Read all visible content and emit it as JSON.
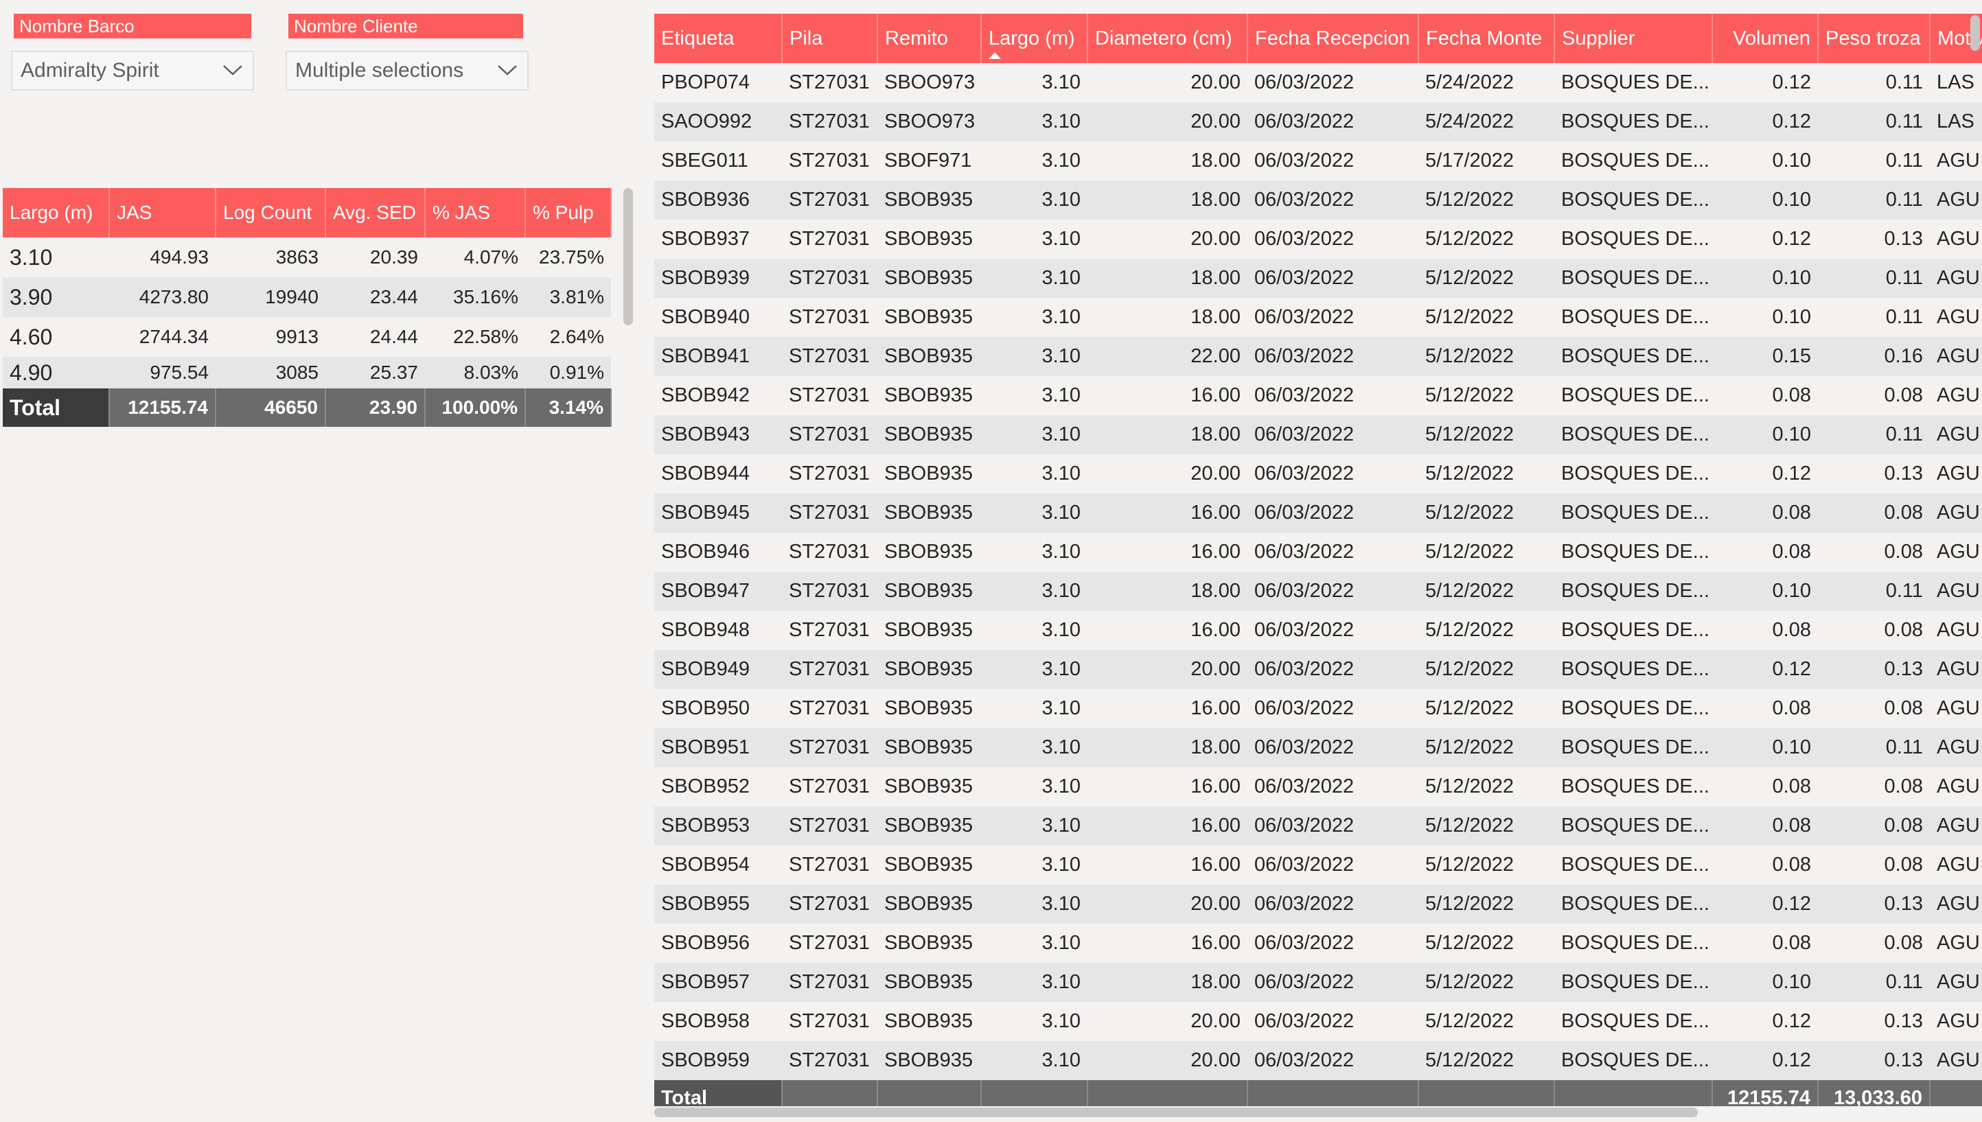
{
  "slicers": [
    {
      "title": "Nombre Barco",
      "value": "Admiralty Spirit"
    },
    {
      "title": "Nombre Cliente",
      "value": "Multiple selections"
    }
  ],
  "summary": {
    "headers": [
      "Largo (m)",
      "JAS",
      "Log Count",
      "Avg. SED",
      "% JAS",
      "% Pulp"
    ],
    "rows": [
      [
        "3.10",
        "494.93",
        "3863",
        "20.39",
        "4.07%",
        "23.75%"
      ],
      [
        "3.90",
        "4273.80",
        "19940",
        "23.44",
        "35.16%",
        "3.81%"
      ],
      [
        "4.60",
        "2744.34",
        "9913",
        "24.44",
        "22.58%",
        "2.64%"
      ],
      [
        "4.90",
        "975.54",
        "3085",
        "25.37",
        "8.03%",
        "0.91%"
      ]
    ],
    "total": [
      "Total",
      "12155.74",
      "46650",
      "23.90",
      "100.00%",
      "3.14%"
    ]
  },
  "detail": {
    "headers": [
      "Etiqueta",
      "Pila",
      "Remito",
      "Largo (m)",
      "Diametero (cm)",
      "Fecha Recepcion",
      "Fecha Monte",
      "Supplier",
      "Volumen",
      "Peso troza",
      "Motivo"
    ],
    "rows": [
      [
        "PBOP074",
        "ST27031",
        "SBOO973",
        "3.10",
        "20.00",
        "06/03/2022",
        "5/24/2022",
        "BOSQUES DE...",
        "0.12",
        "0.11",
        "LAS"
      ],
      [
        "SAOO992",
        "ST27031",
        "SBOO973",
        "3.10",
        "20.00",
        "06/03/2022",
        "5/24/2022",
        "BOSQUES DE...",
        "0.12",
        "0.11",
        "LAS"
      ],
      [
        "SBEG011",
        "ST27031",
        "SBOF971",
        "3.10",
        "18.00",
        "06/03/2022",
        "5/17/2022",
        "BOSQUES DE...",
        "0.10",
        "0.11",
        "AGU"
      ],
      [
        "SBOB936",
        "ST27031",
        "SBOB935",
        "3.10",
        "18.00",
        "06/03/2022",
        "5/12/2022",
        "BOSQUES DE...",
        "0.10",
        "0.11",
        "AGU"
      ],
      [
        "SBOB937",
        "ST27031",
        "SBOB935",
        "3.10",
        "20.00",
        "06/03/2022",
        "5/12/2022",
        "BOSQUES DE...",
        "0.12",
        "0.13",
        "AGU"
      ],
      [
        "SBOB939",
        "ST27031",
        "SBOB935",
        "3.10",
        "18.00",
        "06/03/2022",
        "5/12/2022",
        "BOSQUES DE...",
        "0.10",
        "0.11",
        "AGU"
      ],
      [
        "SBOB940",
        "ST27031",
        "SBOB935",
        "3.10",
        "18.00",
        "06/03/2022",
        "5/12/2022",
        "BOSQUES DE...",
        "0.10",
        "0.11",
        "AGU"
      ],
      [
        "SBOB941",
        "ST27031",
        "SBOB935",
        "3.10",
        "22.00",
        "06/03/2022",
        "5/12/2022",
        "BOSQUES DE...",
        "0.15",
        "0.16",
        "AGU"
      ],
      [
        "SBOB942",
        "ST27031",
        "SBOB935",
        "3.10",
        "16.00",
        "06/03/2022",
        "5/12/2022",
        "BOSQUES DE...",
        "0.08",
        "0.08",
        "AGU"
      ],
      [
        "SBOB943",
        "ST27031",
        "SBOB935",
        "3.10",
        "18.00",
        "06/03/2022",
        "5/12/2022",
        "BOSQUES DE...",
        "0.10",
        "0.11",
        "AGU"
      ],
      [
        "SBOB944",
        "ST27031",
        "SBOB935",
        "3.10",
        "20.00",
        "06/03/2022",
        "5/12/2022",
        "BOSQUES DE...",
        "0.12",
        "0.13",
        "AGU"
      ],
      [
        "SBOB945",
        "ST27031",
        "SBOB935",
        "3.10",
        "16.00",
        "06/03/2022",
        "5/12/2022",
        "BOSQUES DE...",
        "0.08",
        "0.08",
        "AGU"
      ],
      [
        "SBOB946",
        "ST27031",
        "SBOB935",
        "3.10",
        "16.00",
        "06/03/2022",
        "5/12/2022",
        "BOSQUES DE...",
        "0.08",
        "0.08",
        "AGU"
      ],
      [
        "SBOB947",
        "ST27031",
        "SBOB935",
        "3.10",
        "18.00",
        "06/03/2022",
        "5/12/2022",
        "BOSQUES DE...",
        "0.10",
        "0.11",
        "AGU"
      ],
      [
        "SBOB948",
        "ST27031",
        "SBOB935",
        "3.10",
        "16.00",
        "06/03/2022",
        "5/12/2022",
        "BOSQUES DE...",
        "0.08",
        "0.08",
        "AGU"
      ],
      [
        "SBOB949",
        "ST27031",
        "SBOB935",
        "3.10",
        "20.00",
        "06/03/2022",
        "5/12/2022",
        "BOSQUES DE...",
        "0.12",
        "0.13",
        "AGU"
      ],
      [
        "SBOB950",
        "ST27031",
        "SBOB935",
        "3.10",
        "16.00",
        "06/03/2022",
        "5/12/2022",
        "BOSQUES DE...",
        "0.08",
        "0.08",
        "AGU"
      ],
      [
        "SBOB951",
        "ST27031",
        "SBOB935",
        "3.10",
        "18.00",
        "06/03/2022",
        "5/12/2022",
        "BOSQUES DE...",
        "0.10",
        "0.11",
        "AGU"
      ],
      [
        "SBOB952",
        "ST27031",
        "SBOB935",
        "3.10",
        "16.00",
        "06/03/2022",
        "5/12/2022",
        "BOSQUES DE...",
        "0.08",
        "0.08",
        "AGU"
      ],
      [
        "SBOB953",
        "ST27031",
        "SBOB935",
        "3.10",
        "16.00",
        "06/03/2022",
        "5/12/2022",
        "BOSQUES DE...",
        "0.08",
        "0.08",
        "AGU"
      ],
      [
        "SBOB954",
        "ST27031",
        "SBOB935",
        "3.10",
        "16.00",
        "06/03/2022",
        "5/12/2022",
        "BOSQUES DE...",
        "0.08",
        "0.08",
        "AGU"
      ],
      [
        "SBOB955",
        "ST27031",
        "SBOB935",
        "3.10",
        "20.00",
        "06/03/2022",
        "5/12/2022",
        "BOSQUES DE...",
        "0.12",
        "0.13",
        "AGU"
      ],
      [
        "SBOB956",
        "ST27031",
        "SBOB935",
        "3.10",
        "16.00",
        "06/03/2022",
        "5/12/2022",
        "BOSQUES DE...",
        "0.08",
        "0.08",
        "AGU"
      ],
      [
        "SBOB957",
        "ST27031",
        "SBOB935",
        "3.10",
        "18.00",
        "06/03/2022",
        "5/12/2022",
        "BOSQUES DE...",
        "0.10",
        "0.11",
        "AGU"
      ],
      [
        "SBOB958",
        "ST27031",
        "SBOB935",
        "3.10",
        "20.00",
        "06/03/2022",
        "5/12/2022",
        "BOSQUES DE...",
        "0.12",
        "0.13",
        "AGU"
      ],
      [
        "SBOB959",
        "ST27031",
        "SBOB935",
        "3.10",
        "20.00",
        "06/03/2022",
        "5/12/2022",
        "BOSQUES DE...",
        "0.12",
        "0.13",
        "AGU"
      ]
    ],
    "total": [
      "Total",
      "",
      "",
      "",
      "",
      "",
      "",
      "",
      "12155.74",
      "13,033.60",
      ""
    ]
  },
  "colors": {
    "header": "#fd5c5c",
    "alt_row": "#e6e6e6",
    "total": "#6b6b6b"
  }
}
